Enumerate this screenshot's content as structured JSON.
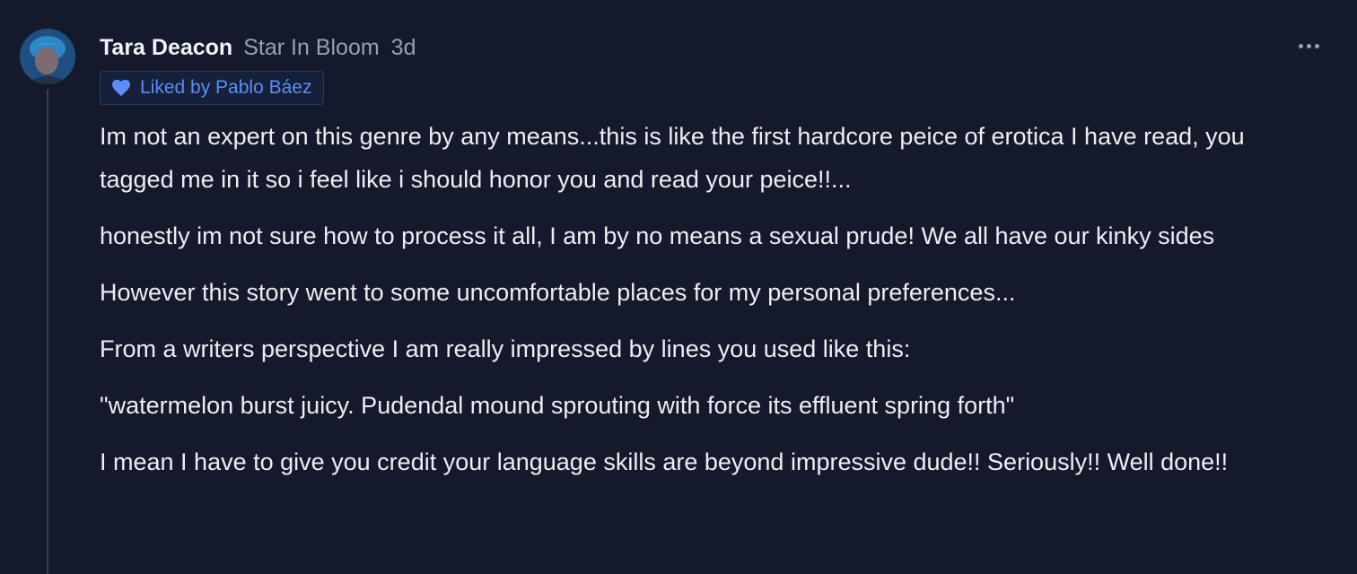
{
  "comment": {
    "author": "Tara Deacon",
    "author_badge": "Star In Bloom",
    "timestamp": "3d",
    "avatar_icon": "user-avatar",
    "more_icon": "more-options-icon",
    "liked_by_text": "Liked by Pablo Báez",
    "liked_icon": "heart-icon",
    "accent_color": "#5b8df5",
    "paragraphs": [
      "Im not an expert on this genre by any means...this is like the first hardcore peice of erotica I have read, you tagged me in it so i feel like i should honor you and read your peice!!...",
      "honestly im not sure how to process it all, I am by no means a sexual prude! We all have our kinky sides",
      "However this story went to some uncomfortable places for my personal preferences...",
      "From a writers perspective I am really impressed by lines you used like this:",
      "\"watermelon burst juicy. Pudendal mound sprouting with force its effluent spring forth\"",
      "I mean I have to give you credit your language skills are beyond impressive dude!! Seriously!! Well done!!"
    ]
  }
}
